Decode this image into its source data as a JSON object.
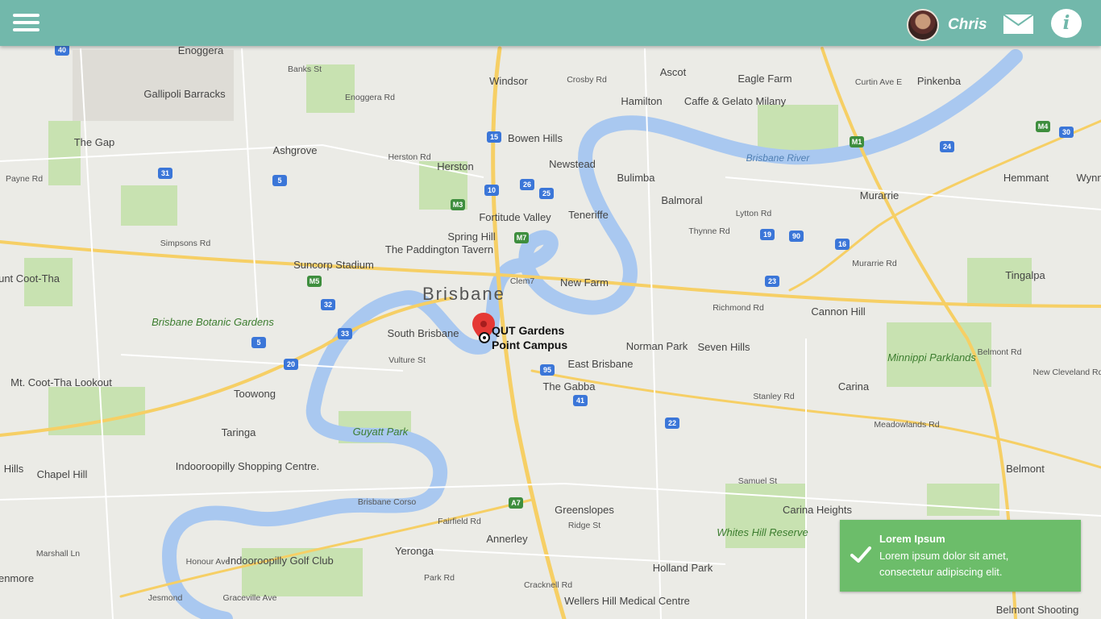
{
  "header": {
    "menu_icon": "hamburger-icon",
    "user_name": "Chris",
    "mail_icon": "mail-icon",
    "info_icon": "info-icon",
    "info_glyph": "i",
    "bar_color": "#72b8ab"
  },
  "map": {
    "city_label": "Brisbane",
    "pin": {
      "label_line1": "QUT Gardens",
      "label_line2": "Point Campus",
      "color": "#e53935"
    },
    "places": [
      "Enoggera",
      "Gallipoli Barracks",
      "Windsor",
      "Crosby Rd",
      "Ascot",
      "Eagle Farm",
      "Pinkenba",
      "Hamilton",
      "Caffe & Gelato Milany",
      "Curtin Ave E",
      "The Gap",
      "Ashgrove",
      "Bowen Hills",
      "Herston",
      "Newstead",
      "Bulimba",
      "Brisbane River",
      "Hemmant",
      "Murarrie",
      "Fortitude Valley",
      "Teneriffe",
      "Balmoral",
      "Spring Hill",
      "The Paddington Tavern",
      "Lytton Rd",
      "Suncorp Stadium",
      "Mount Coot-Tha",
      "New Farm",
      "Tingalpa",
      "Brisbane Botanic Gardens",
      "South Brisbane",
      "Richmond Rd",
      "Cannon Hill",
      "Vulture St",
      "Norman Park",
      "Seven Hills",
      "East Brisbane",
      "Minnippi Parklands",
      "Mt. Coot-Tha Lookout",
      "The Gabba",
      "Carina",
      "Toowong",
      "Stanley Rd",
      "Taringa",
      "Guyatt Park",
      "Meadowlands Rd",
      "Indooroopilly Shopping Centre.",
      "Chapel Hill",
      "Belmont",
      "Samuel St",
      "Brisbane Corso",
      "Greenslopes",
      "Carina Heights",
      "Whites Hill Reserve",
      "Ridge St",
      "Annerley",
      "Yeronga",
      "Indooroopilly Golf Club",
      "Holland Park",
      "Wellers Hill Medical Centre",
      "Belmont Shooting",
      "Hills",
      "enmore",
      "Enoggera Rd",
      "Herston Rd",
      "Banks St",
      "Simpsons Rd",
      "Payne Rd",
      "Clem7",
      "Thynne Rd",
      "Murarrie Rd",
      "Graceville Ave",
      "Honour Ave",
      "Marshall Ln",
      "Fairfield Rd",
      "Park Rd",
      "Cracknell Rd",
      "Jesmond",
      "Belmont Rd",
      "New Cleveland Rd",
      "Wynn"
    ],
    "route_shields": [
      "40",
      "31",
      "5",
      "15",
      "10",
      "26",
      "25",
      "24",
      "30",
      "M4",
      "M1",
      "M3",
      "M5",
      "32",
      "33",
      "20",
      "95",
      "41",
      "22",
      "23",
      "A7",
      "M7",
      "19",
      "90",
      "5",
      "16"
    ]
  },
  "toast": {
    "icon": "checkmark-icon",
    "title": "Lorem Ipsum",
    "body": "Lorem ipsum dolor sit amet, consectetur adipiscing elit.",
    "color": "#6cbd6a"
  }
}
